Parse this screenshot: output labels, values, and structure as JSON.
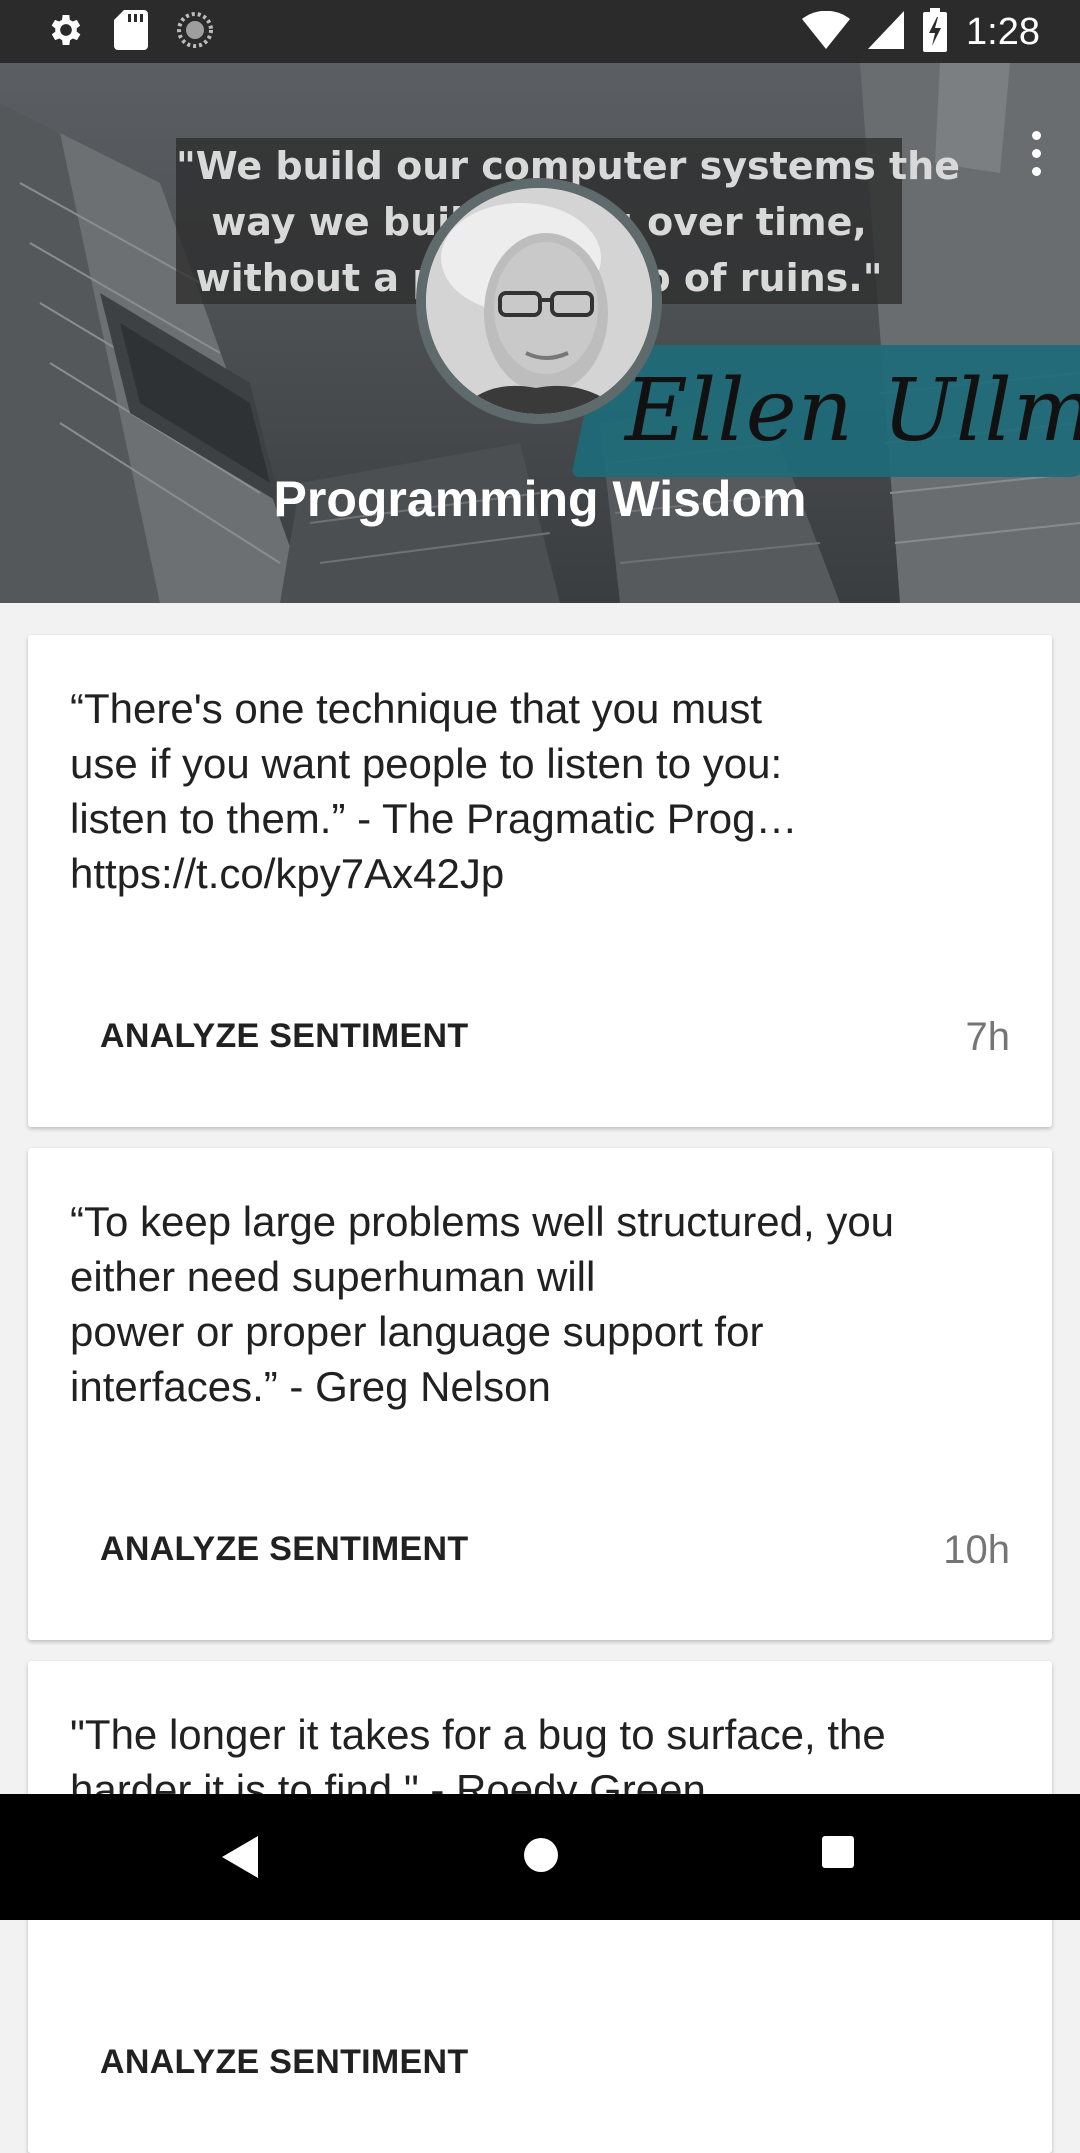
{
  "status_bar": {
    "time": "1:28",
    "left_icons": [
      "settings-icon",
      "sd-card-icon",
      "sync-icon"
    ],
    "right_icons": [
      "wifi-icon",
      "signal-icon",
      "battery-charging-icon"
    ]
  },
  "header": {
    "title": "Programming Wisdom",
    "banner_quote_lines": [
      "\"We build our computer systems the",
      "way we build cities: over time,",
      "without a plan, on top of ruins.\""
    ],
    "signature": "Ellen Ullman",
    "menu_icon": "more-vert-icon"
  },
  "cards": [
    {
      "text_lines": [
        "“There's one technique that you must",
        "use if you want people to listen to you:",
        "listen to them.” - The Pragmatic Prog…",
        "https://t.co/kpy7Ax42Jp"
      ],
      "action_label": "ANALYZE SENTIMENT",
      "time": "7h"
    },
    {
      "text_lines": [
        "“To keep large problems well structured, you",
        "either need superhuman will",
        "power or proper language support for",
        "interfaces.” - Greg Nelson"
      ],
      "action_label": "ANALYZE SENTIMENT",
      "time": "10h"
    },
    {
      "text_lines": [
        "\"The longer it takes for a bug to surface, the",
        "harder it is to find.\" - Roedy Green"
      ],
      "action_label": "ANALYZE SENTIMENT",
      "time": ""
    }
  ],
  "nav_bar": {
    "icons": [
      "back-icon",
      "home-icon",
      "recents-icon"
    ]
  },
  "colors": {
    "accent_brush": "#1e6b7a",
    "card_bg": "#ffffff",
    "page_bg": "#f2f2f2"
  }
}
